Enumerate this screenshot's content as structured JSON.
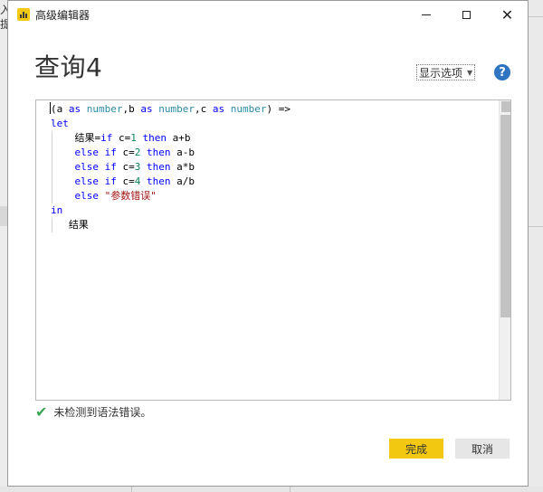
{
  "background": {
    "left_text_1": "入",
    "left_text_2": "提"
  },
  "window": {
    "title": "高级编辑器",
    "minimize_label": "",
    "maximize_label": "",
    "close_label": "✕"
  },
  "header": {
    "query_name": "查询4",
    "options_label": "显示选项",
    "options_caret": "▼",
    "help_label": "?"
  },
  "editor": {
    "lines": [
      [
        {
          "t": "(a ",
          "c": ""
        },
        {
          "t": "as",
          "c": "kw"
        },
        {
          "t": " ",
          "c": ""
        },
        {
          "t": "number",
          "c": "ty"
        },
        {
          "t": ",b ",
          "c": ""
        },
        {
          "t": "as",
          "c": "kw"
        },
        {
          "t": " ",
          "c": ""
        },
        {
          "t": "number",
          "c": "ty"
        },
        {
          "t": ",c ",
          "c": ""
        },
        {
          "t": "as",
          "c": "kw"
        },
        {
          "t": " ",
          "c": ""
        },
        {
          "t": "number",
          "c": "ty"
        },
        {
          "t": ") =>",
          "c": ""
        }
      ],
      [
        {
          "t": "let",
          "c": "kw"
        }
      ],
      [
        {
          "t": "    结果=",
          "c": ""
        },
        {
          "t": "if",
          "c": "kw"
        },
        {
          "t": " c=",
          "c": ""
        },
        {
          "t": "1",
          "c": "num"
        },
        {
          "t": " ",
          "c": ""
        },
        {
          "t": "then",
          "c": "kw"
        },
        {
          "t": " a+b",
          "c": ""
        }
      ],
      [
        {
          "t": "    ",
          "c": ""
        },
        {
          "t": "else if",
          "c": "kw"
        },
        {
          "t": " c=",
          "c": ""
        },
        {
          "t": "2",
          "c": "num"
        },
        {
          "t": " ",
          "c": ""
        },
        {
          "t": "then",
          "c": "kw"
        },
        {
          "t": " a-b",
          "c": ""
        }
      ],
      [
        {
          "t": "    ",
          "c": ""
        },
        {
          "t": "else if",
          "c": "kw"
        },
        {
          "t": " c=",
          "c": ""
        },
        {
          "t": "3",
          "c": "num"
        },
        {
          "t": " ",
          "c": ""
        },
        {
          "t": "then",
          "c": "kw"
        },
        {
          "t": " a*b",
          "c": ""
        }
      ],
      [
        {
          "t": "    ",
          "c": ""
        },
        {
          "t": "else if",
          "c": "kw"
        },
        {
          "t": " c=",
          "c": ""
        },
        {
          "t": "4",
          "c": "num"
        },
        {
          "t": " ",
          "c": ""
        },
        {
          "t": "then",
          "c": "kw"
        },
        {
          "t": " a/b",
          "c": ""
        }
      ],
      [
        {
          "t": "    ",
          "c": ""
        },
        {
          "t": "else",
          "c": "kw"
        },
        {
          "t": " ",
          "c": ""
        },
        {
          "t": "\"参数错误\"",
          "c": "str"
        }
      ],
      [
        {
          "t": "in",
          "c": "kw"
        }
      ],
      [
        {
          "t": "   结果",
          "c": ""
        }
      ]
    ]
  },
  "status": {
    "icon": "✔",
    "message": "未检测到语法错误。"
  },
  "footer": {
    "done_label": "完成",
    "cancel_label": "取消"
  },
  "colors": {
    "accent": "#f2c811",
    "keyword": "#0000ff",
    "type": "#2b8aa6",
    "number": "#098658",
    "string": "#a31515",
    "success": "#3aa757",
    "help": "#2f74c0"
  }
}
